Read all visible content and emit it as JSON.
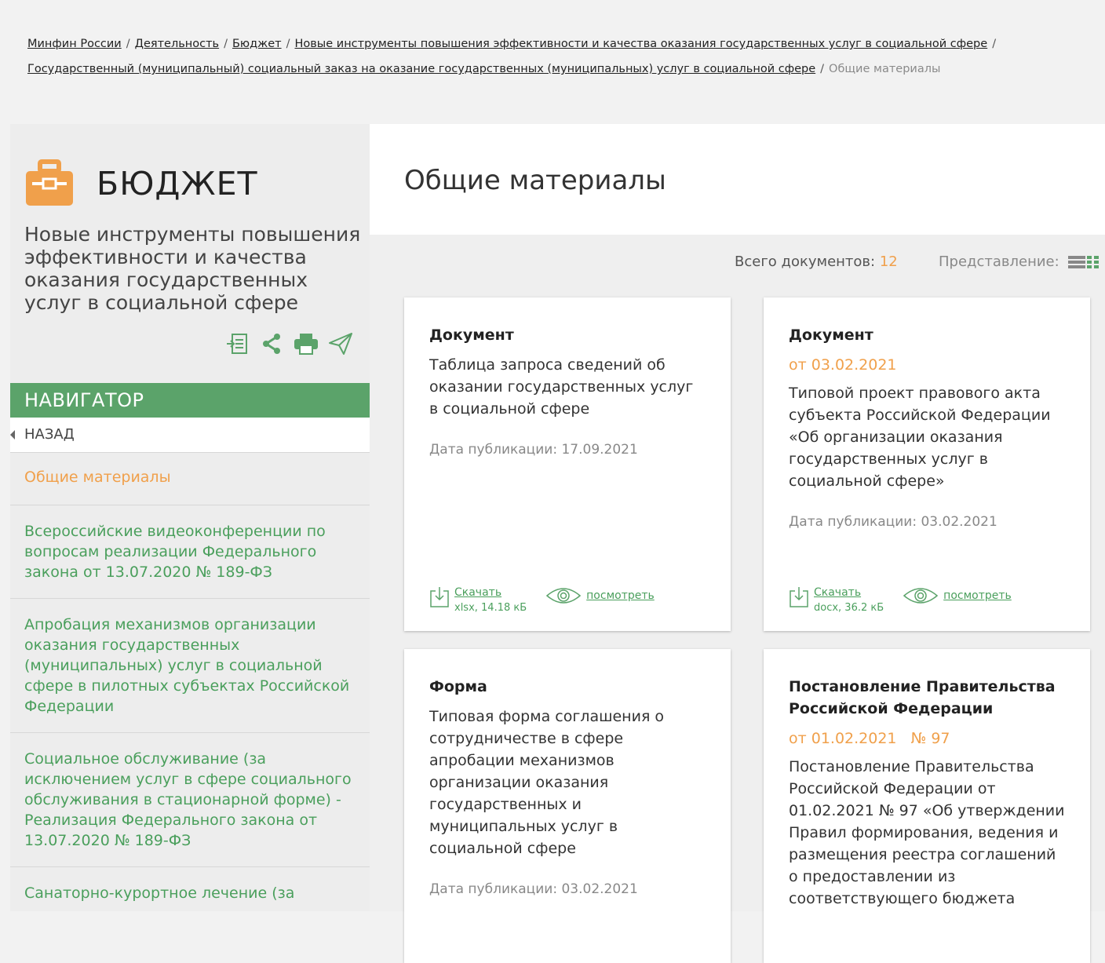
{
  "breadcrumb": {
    "items": [
      "Минфин России",
      "Деятельность",
      "Бюджет",
      "Новые инструменты повышения эффективности и качества оказания государственных услуг в социальной сфере",
      "Государственный (муниципальный) социальный заказ на оказание государственных (муниципальных) услуг в социальной сфере"
    ],
    "current": "Общие материалы",
    "separator": "/"
  },
  "sidebar": {
    "title": "БЮДЖЕТ",
    "icon": "briefcase-icon",
    "subtitle": "Новые инструменты повышения эффективности и качества оказания государственных услуг в социальной сфере",
    "tools": [
      "export-icon",
      "share-icon",
      "print-icon",
      "send-icon"
    ],
    "navigator_title": "НАВИГАТОР",
    "back_label": "НАЗАД",
    "nav_items": [
      "Общие материалы",
      "Всероссийские видеоконференции по вопросам реализации Федерального закона от 13.07.2020 № 189-ФЗ",
      "Апробация механизмов организации оказания государственных (муниципальных) услуг в социальной сфере в пилотных субъектах Российской Федерации",
      "Социальное обслуживание (за исключением услуг в сфере социального обслуживания в стационарной форме) - Реализация Федерального закона от 13.07.2020 № 189-ФЗ",
      "Санаторно-курортное лечение (за"
    ]
  },
  "main": {
    "title": "Общие материалы",
    "total_label": "Всего документов:",
    "total_count": "12",
    "view_label": "Представление:"
  },
  "cards": [
    {
      "type": "Документ",
      "description": "Таблица запроса сведений об оказании государственных услуг в социальной сфере",
      "published": "Дата публикации: 17.09.2021",
      "download_label": "Скачать",
      "file_info": "xlsx, 14.18 кБ",
      "view_label": "посмотреть"
    },
    {
      "type": "Документ",
      "date": "от 03.02.2021",
      "description": "Типовой проект правового акта субъекта Российской Федерации «Об организации оказания государственных услуг в социальной сфере»",
      "published": "Дата публикации: 03.02.2021",
      "download_label": "Скачать",
      "file_info": "docx, 36.2 кБ",
      "view_label": "посмотреть"
    },
    {
      "type": "Форма",
      "description": "Типовая форма соглашения о сотрудничестве в сфере апробации механизмов организации оказания государственных и муниципальных услуг в социальной сфере",
      "published": "Дата публикации: 03.02.2021"
    },
    {
      "type": "Постановление Правительства Российской Федерации",
      "date": "от 01.02.2021",
      "number": "№ 97",
      "description": "Постановление Правительства Российской Федерации от 01.02.2021 № 97 «Об утверждении Правил формирования, ведения и размещения реестра соглашений о предоставлении из соответствующего бюджета"
    }
  ],
  "colors": {
    "accent_green": "#5ba36a",
    "link_green": "#4a9f5c",
    "accent_orange": "#f0a04b"
  }
}
